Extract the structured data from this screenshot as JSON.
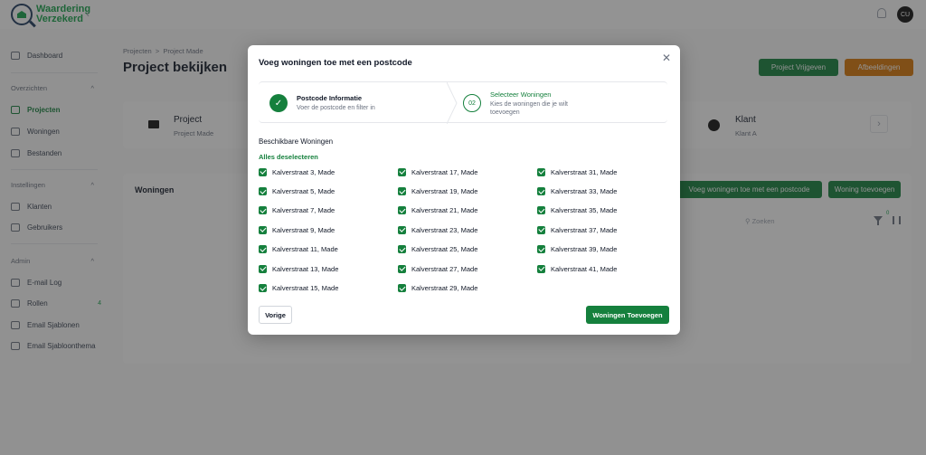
{
  "app": {
    "logo_line1": "Waardering",
    "logo_line2": "Verzekerd",
    "avatar_initials": "CU"
  },
  "sidebar": {
    "dashboard": "Dashboard",
    "group_overzichten": "Overzichten",
    "projecten": "Projecten",
    "woningen": "Woningen",
    "bestanden": "Bestanden",
    "group_instellingen": "Instellingen",
    "klanten": "Klanten",
    "gebruikers": "Gebruikers",
    "group_admin": "Admin",
    "email_log": "E-mail Log",
    "rollen": "Rollen",
    "rollen_count": "4",
    "email_sjablonen": "Email Sjablonen",
    "email_sjabloonthema": "Email Sjabloonthema"
  },
  "page": {
    "breadcrumb_root": "Projecten",
    "breadcrumb_sep": ">",
    "breadcrumb_current": "Project Made",
    "title": "Project bekijken",
    "btn_vrijgeven": "Project Vrijgeven",
    "btn_afbeeldingen": "Afbeeldingen",
    "project_label": "Project",
    "project_value": "Project Made",
    "klant_label": "Klant",
    "klant_value": "Klant A",
    "woningen_title": "Woningen",
    "btn_postcode": "Voeg woningen toe met een postcode",
    "btn_woning": "Woning toevoegen",
    "search_placeholder": "Zoeken",
    "filter_count": "0"
  },
  "modal": {
    "title": "Voeg woningen toe met een postcode",
    "step1_title": "Postcode Informatie",
    "step1_sub": "Voer de postcode en filter in",
    "step2_number": "02",
    "step2_title": "Selecteer Woningen",
    "step2_sub": "Kies de woningen die je wilt toevoegen",
    "section_label": "Beschikbare Woningen",
    "deselect_all": "Alles deselecteren",
    "col1": [
      "Kalverstraat 3, Made",
      "Kalverstraat 5, Made",
      "Kalverstraat 7, Made",
      "Kalverstraat 9, Made",
      "Kalverstraat 11, Made",
      "Kalverstraat 13, Made",
      "Kalverstraat 15, Made"
    ],
    "col2": [
      "Kalverstraat 17, Made",
      "Kalverstraat 19, Made",
      "Kalverstraat 21, Made",
      "Kalverstraat 23, Made",
      "Kalverstraat 25, Made",
      "Kalverstraat 27, Made",
      "Kalverstraat 29, Made"
    ],
    "col3": [
      "Kalverstraat 31, Made",
      "Kalverstraat 33, Made",
      "Kalverstraat 35, Made",
      "Kalverstraat 37, Made",
      "Kalverstraat 39, Made",
      "Kalverstraat 41, Made"
    ],
    "btn_prev": "Vorige",
    "btn_submit": "Woningen Toevoegen"
  },
  "colors": {
    "accent": "#15803d",
    "orange": "#d97706"
  }
}
